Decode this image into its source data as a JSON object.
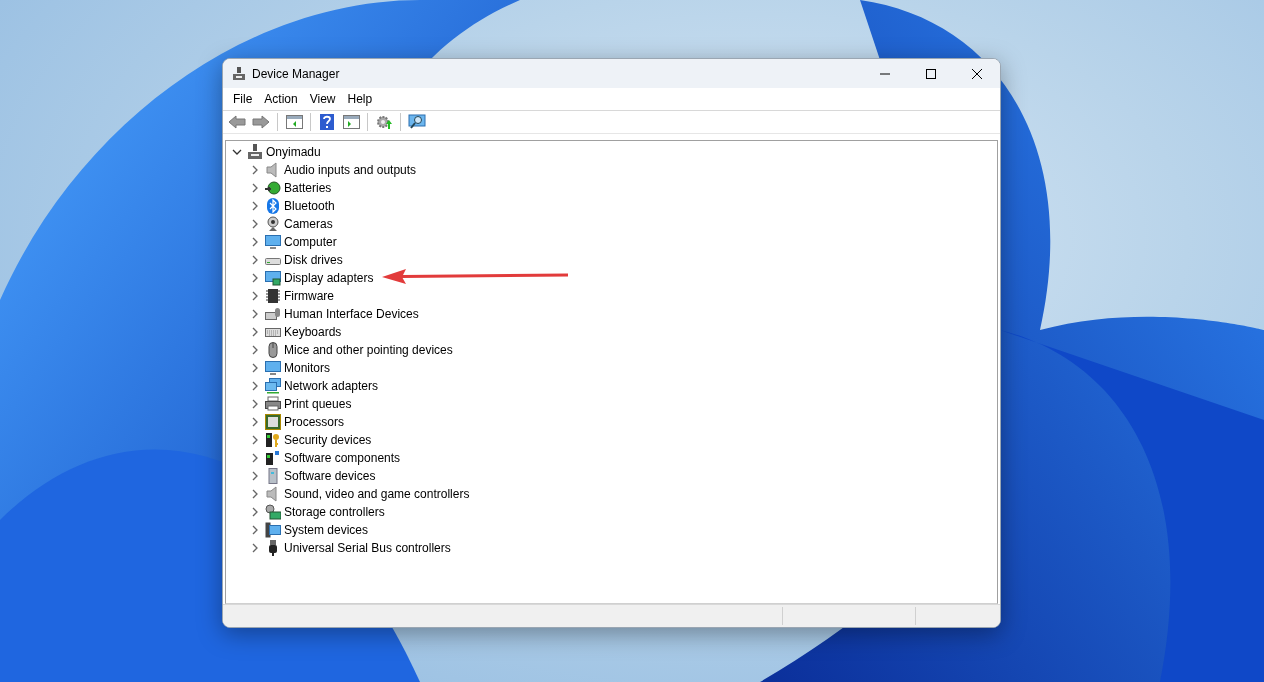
{
  "window": {
    "title": "Device Manager"
  },
  "menu": [
    "File",
    "Action",
    "View",
    "Help"
  ],
  "tree": {
    "label": "Onyimadu",
    "expanded": true,
    "children": [
      {
        "label": "Audio inputs and outputs",
        "expanded": false
      },
      {
        "label": "Batteries",
        "expanded": false
      },
      {
        "label": "Bluetooth",
        "expanded": false
      },
      {
        "label": "Cameras",
        "expanded": false
      },
      {
        "label": "Computer",
        "expanded": false
      },
      {
        "label": "Disk drives",
        "expanded": false
      },
      {
        "label": "Display adapters",
        "expanded": false
      },
      {
        "label": "Firmware",
        "expanded": false
      },
      {
        "label": "Human Interface Devices",
        "expanded": false
      },
      {
        "label": "Keyboards",
        "expanded": false
      },
      {
        "label": "Mice and other pointing devices",
        "expanded": false
      },
      {
        "label": "Monitors",
        "expanded": false
      },
      {
        "label": "Network adapters",
        "expanded": false
      },
      {
        "label": "Print queues",
        "expanded": false
      },
      {
        "label": "Processors",
        "expanded": false
      },
      {
        "label": "Security devices",
        "expanded": false
      },
      {
        "label": "Software components",
        "expanded": false
      },
      {
        "label": "Software devices",
        "expanded": false
      },
      {
        "label": "Sound, video and game controllers",
        "expanded": false
      },
      {
        "label": "Storage controllers",
        "expanded": false
      },
      {
        "label": "System devices",
        "expanded": false
      },
      {
        "label": "Universal Serial Bus controllers",
        "expanded": false
      }
    ]
  }
}
